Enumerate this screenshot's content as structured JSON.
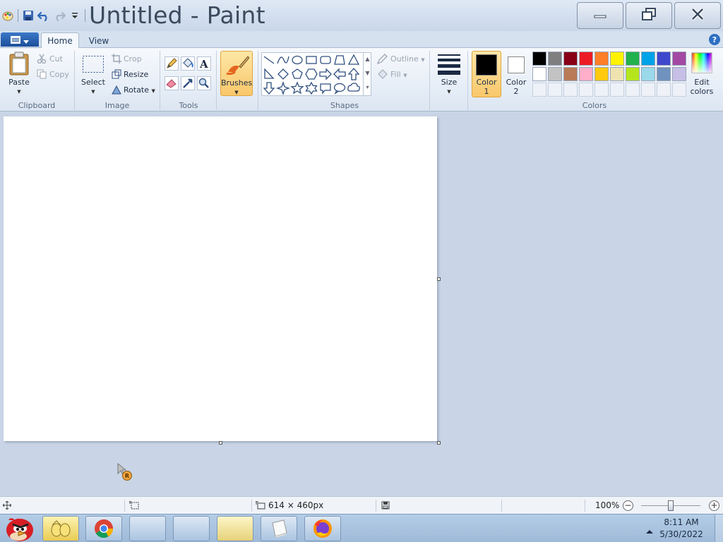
{
  "window": {
    "title": "Untitled - Paint"
  },
  "tabs": [
    {
      "label": "Home",
      "active": true
    },
    {
      "label": "View",
      "active": false
    }
  ],
  "ribbon": {
    "clipboard": {
      "group": "Clipboard",
      "paste": "Paste",
      "cut": "Cut",
      "copy": "Copy"
    },
    "image": {
      "group": "Image",
      "select": "Select",
      "crop": "Crop",
      "resize": "Resize",
      "rotate": "Rotate"
    },
    "tools": {
      "group": "Tools"
    },
    "brushes": {
      "label": "Brushes"
    },
    "shapes": {
      "group": "Shapes",
      "outline": "Outline",
      "fill": "Fill"
    },
    "size": {
      "label": "Size"
    },
    "colors": {
      "group": "Colors",
      "color1_line1": "Color",
      "color1_line2": "1",
      "color2_line1": "Color",
      "color2_line2": "2",
      "edit_line1": "Edit",
      "edit_line2": "colors",
      "row1": [
        "#000000",
        "#7f7f7f",
        "#880015",
        "#ed1c24",
        "#ff7f27",
        "#fff200",
        "#22b14c",
        "#00a2e8",
        "#3f48cc",
        "#a349a4"
      ],
      "row2": [
        "#ffffff",
        "#c3c3c3",
        "#b97a57",
        "#ffaec9",
        "#ffc90e",
        "#efe4b0",
        "#b5e61d",
        "#99d9ea",
        "#7092be",
        "#c8bfe7"
      ]
    }
  },
  "status": {
    "canvas_size": "614 × 460px",
    "zoom": "100%"
  },
  "taskbar": {
    "time": "8:11 AM",
    "date": "5/30/2022"
  },
  "cursor_badge": "R"
}
